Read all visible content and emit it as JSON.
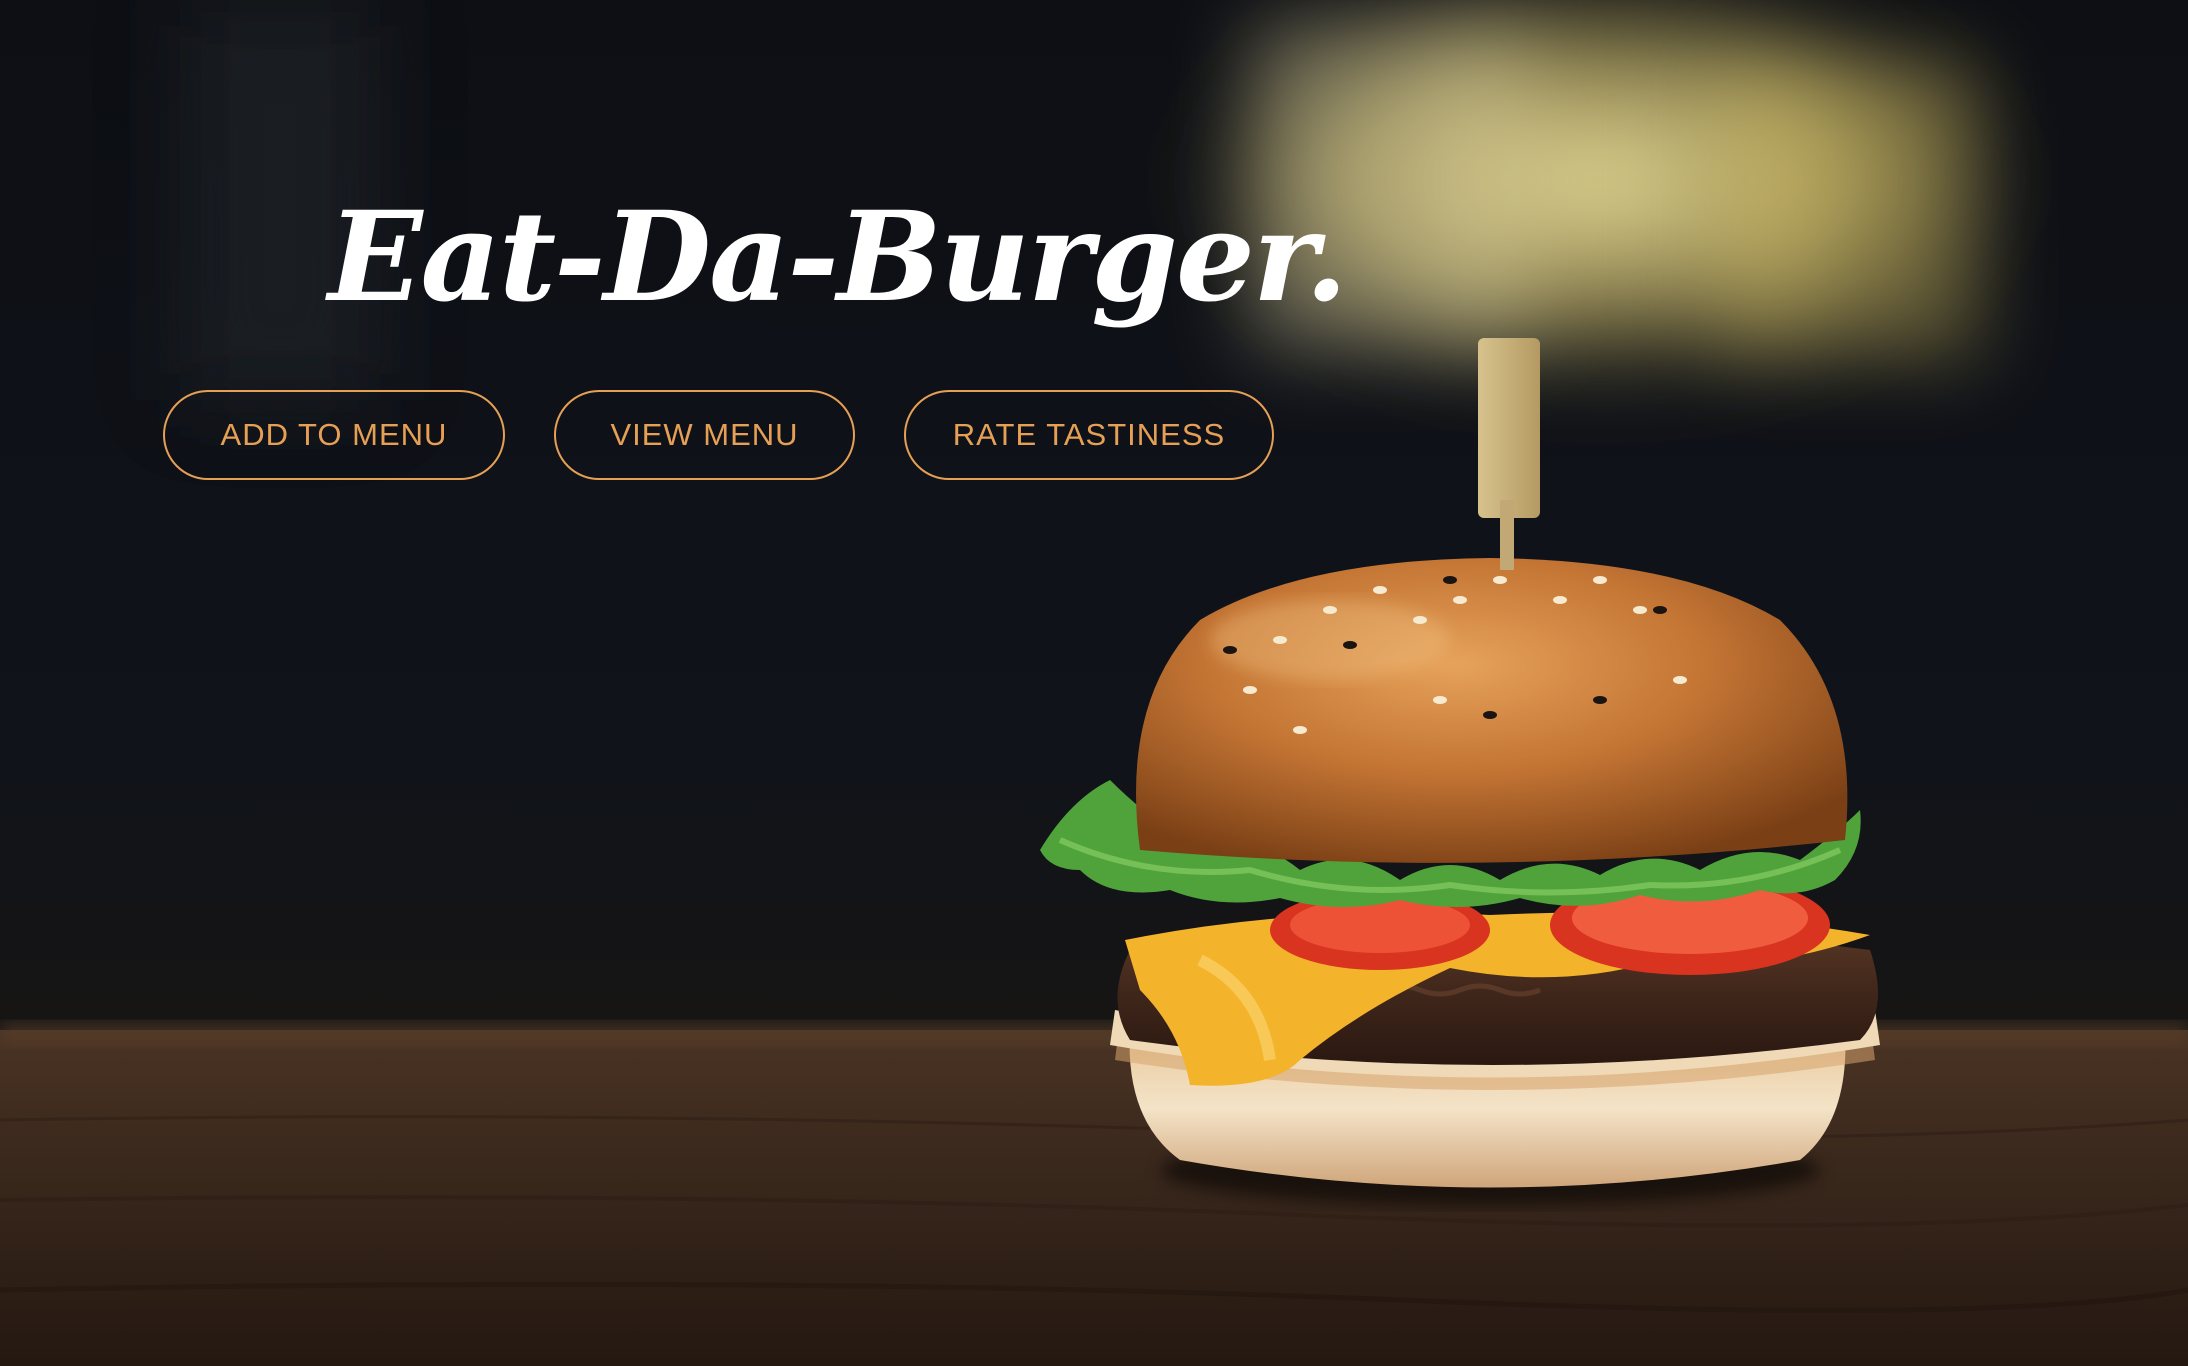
{
  "hero": {
    "title": "Eat-Da-Burger."
  },
  "buttons": {
    "add_to_menu": "ADD TO MENU",
    "view_menu": "VIEW MENU",
    "rate_tastiness": "RATE TASTINESS"
  },
  "colors": {
    "accent": "#e6a055",
    "title": "#ffffff",
    "background": "#0b0d12"
  },
  "image": {
    "subject": "burger-photo"
  }
}
